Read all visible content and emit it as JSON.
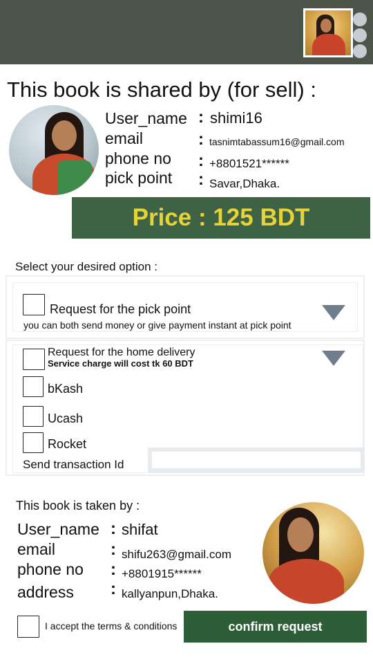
{
  "header": {
    "profile_icon": "user-avatar",
    "menu_icon": "vertical-dots"
  },
  "title": "This book is shared by (for sell) :",
  "seller": {
    "labels": {
      "user_name": "User_name",
      "email": "email",
      "phone": "phone no",
      "pick_point": "pick point"
    },
    "values": {
      "user_name": "shimi16",
      "email": "tasnimtabassum16@gmail.com",
      "phone": "+8801521******",
      "pick_point": "Savar,Dhaka."
    }
  },
  "price": {
    "text": "Price : 125 BDT",
    "bg_color": "#3e6344",
    "text_color": "#e7d337"
  },
  "options": {
    "label": "Select your desired option :",
    "pick_point": {
      "title": "Request for the pick point",
      "subtitle": "you can both send money or give payment instant at pick point"
    },
    "home_delivery": {
      "title": "Request for the home delivery",
      "subtitle": "Service charge will cost tk 60 BDT"
    },
    "payment_methods": [
      "bKash",
      "Ucash",
      "Rocket"
    ],
    "transaction_label": "Send transaction Id",
    "transaction_value": ""
  },
  "buyer": {
    "label": "This book is taken by :",
    "labels": {
      "user_name": "User_name",
      "email": "email",
      "phone": "phone no",
      "address": "address"
    },
    "values": {
      "user_name": "shifat",
      "email": "shifu263@gmail.com",
      "phone": "+8801915******",
      "address": "kallyanpun,Dhaka."
    }
  },
  "footer": {
    "terms_text": "I accept the terms & conditions",
    "confirm_label": "confirm request",
    "confirm_color": "#2e5e38"
  }
}
